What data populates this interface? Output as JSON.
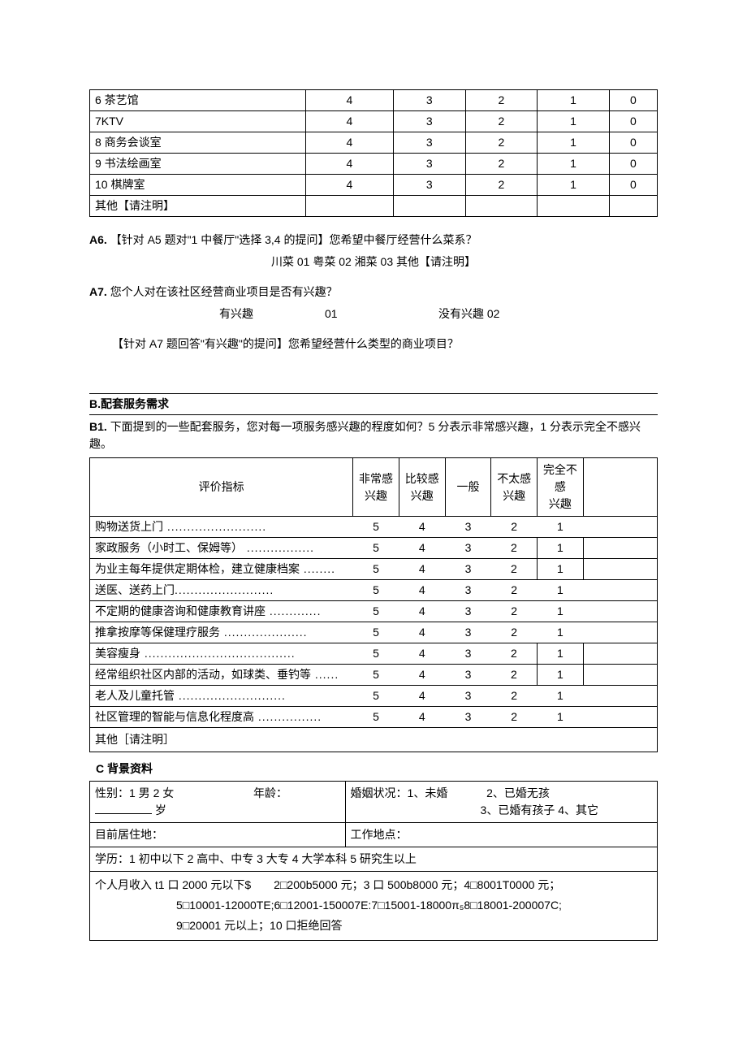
{
  "table1": {
    "rows": [
      {
        "label": "6 茶艺馆",
        "c": [
          "4",
          "3",
          "2",
          "1",
          "0"
        ]
      },
      {
        "label": "7KTV",
        "c": [
          "4",
          "3",
          "2",
          "1",
          "0"
        ]
      },
      {
        "label": "8 商务会谈室",
        "c": [
          "4",
          "3",
          "2",
          "1",
          "0"
        ]
      },
      {
        "label": "9 书法绘画室",
        "c": [
          "4",
          "3",
          "2",
          "1",
          "0"
        ]
      },
      {
        "label": "10 棋牌室",
        "c": [
          "4",
          "3",
          "2",
          "1",
          "0"
        ]
      },
      {
        "label": "其他【请注明】",
        "c": [
          "",
          "",
          "",
          "",
          ""
        ]
      }
    ]
  },
  "a6": {
    "prefix": "A6.",
    "text": "【针对 A5 题对\"1 中餐厅\"选择 3,4 的提问】您希望中餐厅经营什么菜系？",
    "opts": "川菜 01 粤菜 02 湘菜 03 其他【请注明】"
  },
  "a7": {
    "prefix": "A7.",
    "text": "您个人对在该社区经营商业项目是否有兴趣？",
    "opt1": "有兴趣",
    "code1": "01",
    "opt2": "没有兴趣 02",
    "follow": "【针对 A7 题回答\"有兴趣\"的提问】您希望经营什么类型的商业项目？"
  },
  "sectionB": "B.配套服务需求",
  "b1": {
    "prefix": "B1.",
    "text": "下面提到的一些配套服务，您对每一项服务感兴趣的程度如何？5 分表示非常感兴趣，1 分表示完全不感兴趣。",
    "head": [
      "评价指标",
      "非常感兴趣",
      "比较感兴趣",
      "一般",
      "不太感兴趣",
      "完全不感兴趣"
    ],
    "rows": [
      {
        "label": "购物送货上门",
        "dots": " .........................",
        "v": [
          "5",
          "4",
          "3",
          "2",
          "1"
        ],
        "box": false
      },
      {
        "label": "家政服务（小时工、保姆等）",
        "dots": " .................",
        "v": [
          "5",
          "4",
          "3",
          "2",
          "1"
        ],
        "box": true
      },
      {
        "label": "为业主每年提供定期体检，建立健康档案",
        "dots": " ........",
        "v": [
          "5",
          "4",
          "3",
          "2",
          "1"
        ],
        "box": true
      },
      {
        "label": "送医、送药上门",
        "dots": ".........................",
        "v": [
          "5",
          "4",
          "3",
          "2",
          "1"
        ],
        "box": false
      },
      {
        "label": "不定期的健康咨询和健康教育讲座",
        "dots": " .............",
        "v": [
          "5",
          "4",
          "3",
          "2",
          "1"
        ],
        "box": false
      },
      {
        "label": "推拿按摩等保健理疗服务",
        "dots": " .....................",
        "v": [
          "5",
          "4",
          "3",
          "2",
          "1"
        ],
        "box": false
      },
      {
        "label": "美容瘦身",
        "dots": " ......................................",
        "v": [
          "5",
          "4",
          "3",
          "2",
          "1"
        ],
        "box": true
      },
      {
        "label": "经常组织社区内部的活动，如球类、垂钓等",
        "dots": " ......",
        "v": [
          "5",
          "4",
          "3",
          "2",
          "1"
        ],
        "box": true
      },
      {
        "label": "老人及儿童托管",
        "dots": " ...........................",
        "v": [
          "5",
          "4",
          "3",
          "2",
          "1"
        ],
        "box": false
      },
      {
        "label": "社区管理的智能与信息化程度高",
        "dots": " ................",
        "v": [
          "5",
          "4",
          "3",
          "2",
          "1"
        ],
        "box": false
      }
    ],
    "other": "其他［请注明］"
  },
  "sectionC": "C 背景资料",
  "bg": {
    "gender": "性别：1 男 2 女",
    "age_label": "年龄：",
    "age_unit": "岁",
    "marital1": "婚姻状况：1、未婚",
    "marital2": "2、已婚无孩",
    "marital3": "3、已婚有孩子 4、其它",
    "residence": "目前居住地：",
    "workplace": "工作地点：",
    "education": "学历：1 初中以下 2 高中、中专 3 大专 4 大学本科 5 研究生以上",
    "income1": "个人月收入 t1 口 2000 元以下$　　2□200b5000 元；3 口 500b8000 元；4□8001T0000 元；",
    "income2": "5□10001-12000TE;6□12001-150007E:7□15001-18000π₅8□18001-200007C;",
    "income3": "9□20001 元以上；10 口拒绝回答"
  }
}
